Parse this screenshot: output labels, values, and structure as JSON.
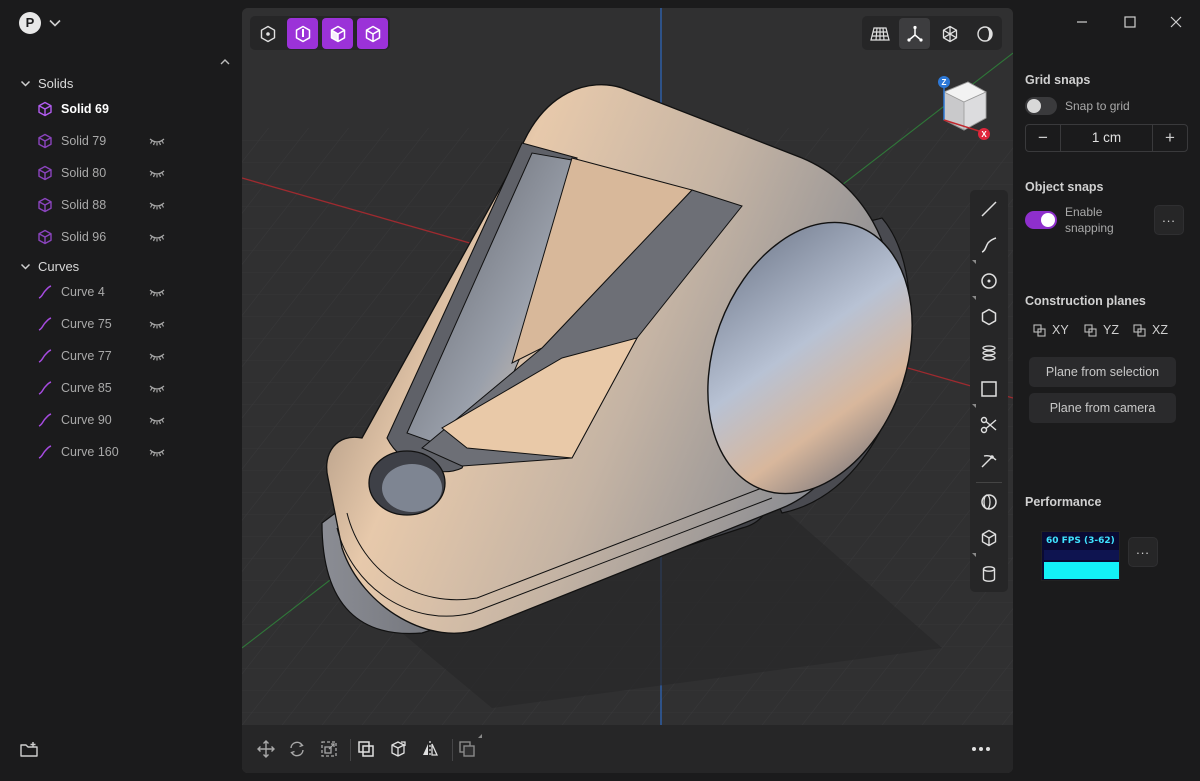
{
  "user": {
    "avatar_letter": "P"
  },
  "outliner": {
    "groups": [
      {
        "label": "Solids",
        "items": [
          {
            "label": "Solid 69",
            "selected": true
          },
          {
            "label": "Solid 79"
          },
          {
            "label": "Solid 80"
          },
          {
            "label": "Solid 88"
          },
          {
            "label": "Solid 96"
          }
        ]
      },
      {
        "label": "Curves",
        "items": [
          {
            "label": "Curve 4"
          },
          {
            "label": "Curve 75"
          },
          {
            "label": "Curve 77"
          },
          {
            "label": "Curve 85"
          },
          {
            "label": "Curve 90"
          },
          {
            "label": "Curve 160"
          }
        ]
      }
    ]
  },
  "viewport": {
    "view_cube": {
      "axis_z": "Z",
      "axis_x": "X"
    }
  },
  "right_panel": {
    "grid_snaps": {
      "title": "Grid snaps",
      "snap_to_grid_label": "Snap to grid",
      "snap_to_grid_on": false,
      "minus": "−",
      "value": "1 cm",
      "plus": "+"
    },
    "object_snaps": {
      "title": "Object snaps",
      "enable_line1": "Enable",
      "enable_line2": "snapping",
      "enabled": true,
      "more": "..."
    },
    "construction_planes": {
      "title": "Construction planes",
      "planes": [
        "XY",
        "YZ",
        "XZ"
      ],
      "from_selection": "Plane from selection",
      "from_camera": "Plane from camera"
    },
    "performance": {
      "title": "Performance",
      "fps": "60 FPS (3-62)",
      "more": "..."
    }
  },
  "colors": {
    "accent": "#9b32d8",
    "solid_icon": "#a64be0",
    "curve_icon": "#a64be0",
    "axis_x": "#c0282e",
    "axis_y": "#2f9a3c",
    "axis_z": "#2d78d6"
  }
}
